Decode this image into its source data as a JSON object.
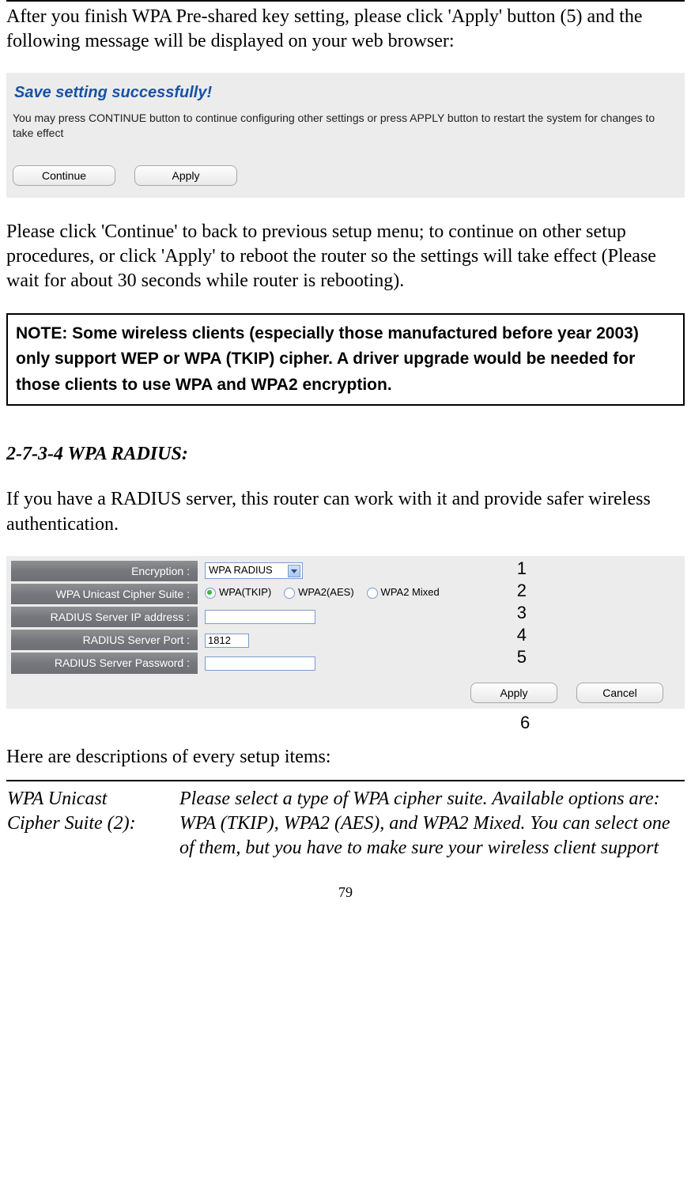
{
  "intro1": "After you finish WPA Pre-shared key setting, please click 'Apply' button (5) and the following message will be displayed on your web browser:",
  "savePanel": {
    "title": "Save setting successfully!",
    "desc": "You may press CONTINUE button to continue configuring other settings or press APPLY button to restart the system for changes to take effect",
    "continueLabel": "Continue",
    "applyLabel": "Apply"
  },
  "intro2": "Please click 'Continue' to back to previous setup menu; to continue on other setup procedures, or click 'Apply' to reboot the router so the settings will take effect (Please wait for about 30 seconds while router is rebooting).",
  "note": "NOTE: Some wireless clients (especially those manufactured before year 2003) only support WEP or WPA (TKIP) cipher. A driver upgrade would be needed for those clients to use WPA and WPA2 encryption.",
  "sectionHeading": "2-7-3-4 WPA RADIUS:",
  "intro3": "If you have a RADIUS server, this router can work with it and provide safer wireless authentication.",
  "form": {
    "rows": {
      "encryption": {
        "label": "Encryption :",
        "value": "WPA RADIUS"
      },
      "cipher": {
        "label": "WPA Unicast Cipher Suite :",
        "options": [
          "WPA(TKIP)",
          "WPA2(AES)",
          "WPA2 Mixed"
        ],
        "selected": 0
      },
      "ip": {
        "label": "RADIUS Server IP address :",
        "value": ""
      },
      "port": {
        "label": "RADIUS Server Port :",
        "value": "1812"
      },
      "pw": {
        "label": "RADIUS Server Password :",
        "value": ""
      }
    },
    "applyLabel": "Apply",
    "cancelLabel": "Cancel"
  },
  "callouts": {
    "c1": "1",
    "c2": "2",
    "c3": "3",
    "c4": "4",
    "c5": "5",
    "c6": "6"
  },
  "descIntro": "Here are descriptions of every setup items:",
  "descTable": {
    "termLine1": "WPA Unicast",
    "termLine2": "Cipher Suite (2):",
    "def": "Please select a type of WPA cipher suite. Available options are: WPA (TKIP), WPA2 (AES), and WPA2 Mixed. You can select one of them, but you have to make sure your wireless client support"
  },
  "pageNumber": "79"
}
